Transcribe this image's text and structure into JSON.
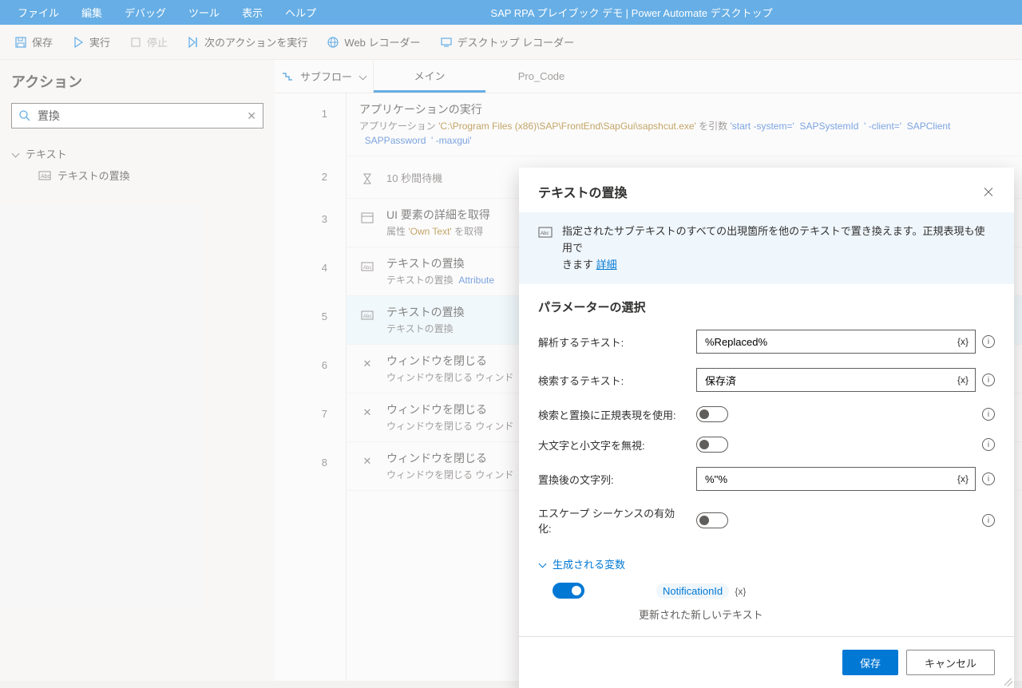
{
  "menu": {
    "items": [
      "ファイル",
      "編集",
      "デバッグ",
      "ツール",
      "表示",
      "ヘルプ"
    ],
    "title": "SAP RPA プレイブック デモ | Power Automate デスクトップ"
  },
  "toolbar": {
    "save": "保存",
    "run": "実行",
    "stop": "停止",
    "next": "次のアクションを実行",
    "webrec": "Web レコーダー",
    "deskrec": "デスクトップ レコーダー"
  },
  "sidebar": {
    "heading": "アクション",
    "search_value": "置換",
    "category": "テキスト",
    "leaf": "テキストの置換"
  },
  "tabs": {
    "subflow": "サブフロー",
    "main": "メイン",
    "procode": "Pro_Code"
  },
  "steps": [
    {
      "n": "1",
      "title": "アプリケーションの実行",
      "desc_pre": "アプリケーション ",
      "q": "'C:\\Program Files (x86)\\SAP\\FrontEnd\\SapGui\\sapshcut.exe'",
      "mid": " を引数 ",
      "v1": "'start -system='",
      "v2": "SAPSystemId",
      "v3": "' -client='",
      "v4": "SAPClient",
      "v5": "SAPPassword",
      "v6": "' -maxgui'"
    },
    {
      "n": "2",
      "title": "10 秒間待機"
    },
    {
      "n": "3",
      "title": "UI 要素の詳細を取得",
      "desc": "属性 'Own Text' を取得",
      "q": "'Own Text'"
    },
    {
      "n": "4",
      "title": "テキストの置換",
      "desc": "テキストの置換 ",
      "var": "Attribute"
    },
    {
      "n": "5",
      "title": "テキストの置換",
      "desc": "テキストの置換"
    },
    {
      "n": "6",
      "title": "ウィンドウを閉じる",
      "desc": "ウィンドウを閉じる ウィンド"
    },
    {
      "n": "7",
      "title": "ウィンドウを閉じる",
      "desc": "ウィンドウを閉じる ウィンド"
    },
    {
      "n": "8",
      "title": "ウィンドウを閉じる",
      "desc": "ウィンドウを閉じる ウィンド"
    }
  ],
  "dialog": {
    "title": "テキストの置換",
    "info": "指定されたサブテキストのすべての出現箇所を他のテキストで置き換えます。正規表現も使用で",
    "more_pre": "きます ",
    "more": "詳細",
    "params_heading": "パラメーターの選択",
    "rows": {
      "parse": {
        "label": "解析するテキスト:",
        "value": "%Replaced%"
      },
      "find": {
        "label": "検索するテキスト:",
        "value": "保存済"
      },
      "regex": {
        "label": "検索と置換に正規表現を使用:"
      },
      "ignorecase": {
        "label": "大文字と小文字を無視:"
      },
      "replace": {
        "label": "置換後の文字列:",
        "value": "%''%"
      },
      "escape": {
        "label": "エスケープ シーケンスの有効化:"
      }
    },
    "genvars": {
      "heading": "生成される変数",
      "varname": "NotificationId",
      "vx": "{x}",
      "desc": "更新された新しいテキスト"
    },
    "save": "保存",
    "cancel": "キャンセル",
    "vx": "{x}"
  }
}
